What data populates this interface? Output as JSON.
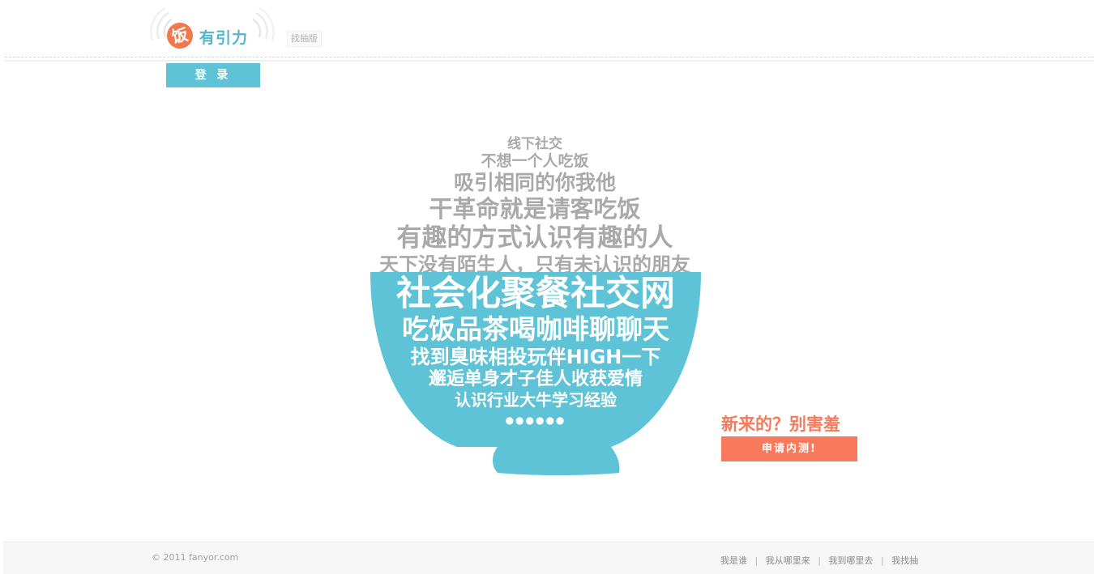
{
  "header": {
    "logo": {
      "badge": "饭",
      "name": "有引力"
    },
    "tag": "找抽版",
    "login_label": "登 录"
  },
  "bowl": {
    "steam_lines": [
      "线下社交",
      "不想一个人吃饭",
      "吸引相同的你我他",
      "干革命就是请客吃饭",
      "有趣的方式认识有趣的人",
      "天下没有陌生人，只有未认识的朋友"
    ],
    "bowl_lines": [
      "社会化聚餐社交网",
      "吃饭品茶喝咖啡聊聊天",
      "找到臭味相投玩伴HIGH一下",
      "邂逅单身才子佳人收获爱情",
      "认识行业大牛学习经验"
    ],
    "dots": "●●●●●●",
    "colors": {
      "bowl": "#5ec3d6",
      "steam_text": "#a9a9a9"
    }
  },
  "signup": {
    "promo": "新来的？别害羞",
    "button_label": "申请内测!",
    "color": "#f8795b"
  },
  "footer": {
    "copyright": "© 2011 fanyor.com",
    "links": [
      "我是谁",
      "我从哪里来",
      "我到哪里去",
      "我找抽"
    ],
    "separator": "|"
  }
}
